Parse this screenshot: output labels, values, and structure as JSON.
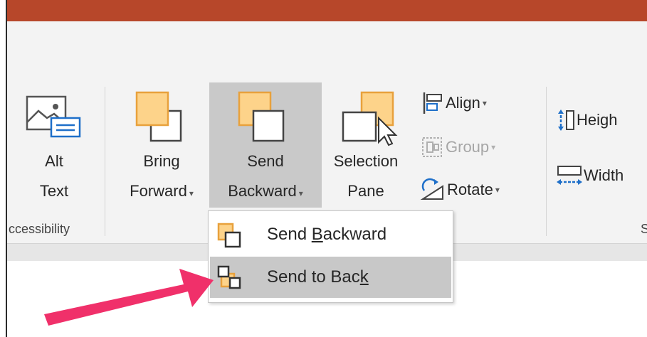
{
  "ribbon": {
    "alt_text": {
      "line1": "Alt",
      "line2": "Text"
    },
    "bring_forward": {
      "line1": "Bring",
      "line2": "Forward"
    },
    "send_backward": {
      "line1": "Send",
      "line2": "Backward"
    },
    "selection_pane": {
      "line1": "Selection",
      "line2": "Pane"
    },
    "align": "Align",
    "group": "Group",
    "rotate": "Rotate",
    "height": "Heigh",
    "width": "Width",
    "accessibility_group": "ccessibility",
    "size_group_partial": "S"
  },
  "dropdown_menu": {
    "items": [
      {
        "pre": "Send ",
        "accel": "B",
        "post": "ackward",
        "state": "normal"
      },
      {
        "pre": "Send to Bac",
        "accel": "k",
        "post": "",
        "state": "hovered"
      }
    ]
  },
  "colors": {
    "title_bar": "#b7472a",
    "ribbon_bg": "#f3f3f3",
    "hover_bg": "#c8c8c8",
    "shape_orange_fill": "#fdd38a",
    "shape_orange_stroke": "#e8a13c",
    "arrow": "#f0306a"
  }
}
